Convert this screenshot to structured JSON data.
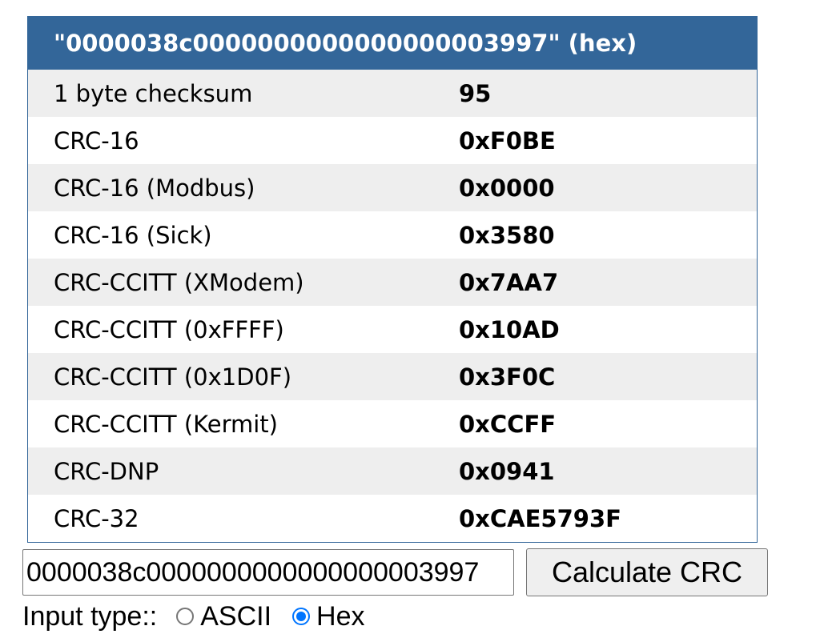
{
  "table": {
    "header": "\"0000038c0000000000000000003997\" (hex)",
    "rows": [
      {
        "name": "1 byte checksum",
        "value": "95"
      },
      {
        "name": "CRC-16",
        "value": "0xF0BE"
      },
      {
        "name": "CRC-16 (Modbus)",
        "value": "0x0000"
      },
      {
        "name": "CRC-16 (Sick)",
        "value": "0x3580"
      },
      {
        "name": "CRC-CCITT (XModem)",
        "value": "0x7AA7"
      },
      {
        "name": "CRC-CCITT (0xFFFF)",
        "value": "0x10AD"
      },
      {
        "name": "CRC-CCITT (0x1D0F)",
        "value": "0x3F0C"
      },
      {
        "name": "CRC-CCITT (Kermit)",
        "value": "0xCCFF"
      },
      {
        "name": "CRC-DNP",
        "value": "0x0941"
      },
      {
        "name": "CRC-32",
        "value": "0xCAE5793F"
      }
    ]
  },
  "form": {
    "input_value": "0000038c0000000000000000003997",
    "button_label": "Calculate CRC",
    "input_type_label": "Input type::",
    "options": [
      {
        "label": "ASCII",
        "checked": false
      },
      {
        "label": "Hex",
        "checked": true
      }
    ]
  },
  "colors": {
    "header_bg": "#336699",
    "row_alt_bg": "#eeeeee",
    "radio_accent": "#0075ff"
  }
}
